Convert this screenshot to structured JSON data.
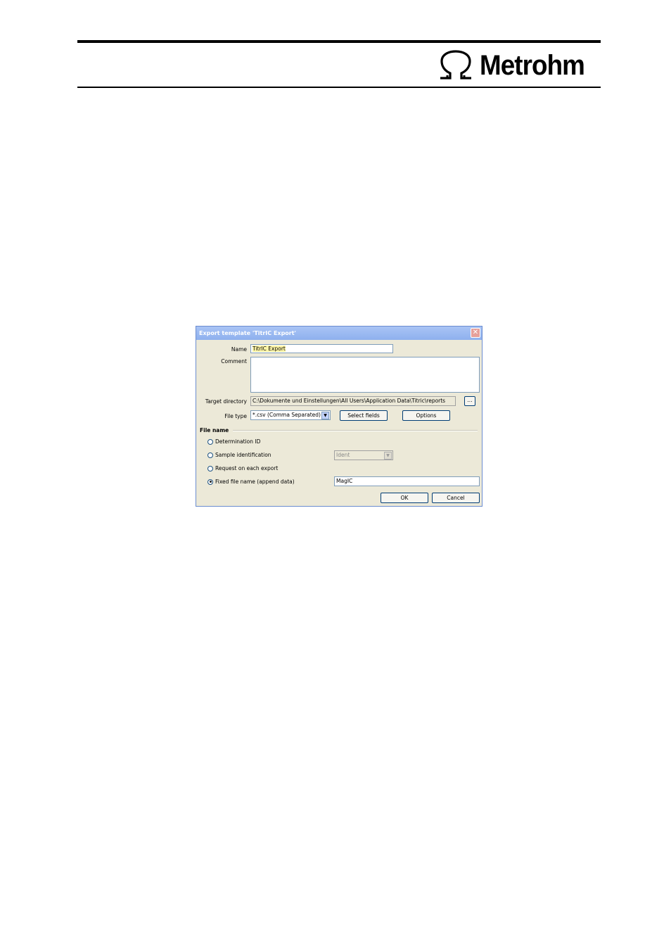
{
  "header": {
    "logo_text": "Metrohm"
  },
  "dialog": {
    "title": "Export template 'TitrIC Export'",
    "close_label": "✕",
    "name_label": "Name",
    "name_value": "TitrIC Export",
    "comment_label": "Comment",
    "comment_value": "",
    "target_directory_label": "Target directory",
    "target_directory_value": "C:\\Dokumente und Einstellungen\\All Users\\Application Data\\Titric\\reports",
    "browse_label": "...",
    "file_type_label": "File type",
    "file_type_value": "*.csv (Comma Separated)",
    "select_fields_label": "Select fields",
    "options_label": "Options",
    "file_name_section": "File name",
    "radios": {
      "determination_id": "Determination ID",
      "sample_identification": "Sample identification",
      "request_on_each_export": "Request on each export",
      "fixed_file_name": "Fixed file name (append data)"
    },
    "selected_radio": "fixed_file_name",
    "ident_value": "Ident",
    "fixed_file_name_value": "MagIC",
    "ok_label": "OK",
    "cancel_label": "Cancel"
  }
}
